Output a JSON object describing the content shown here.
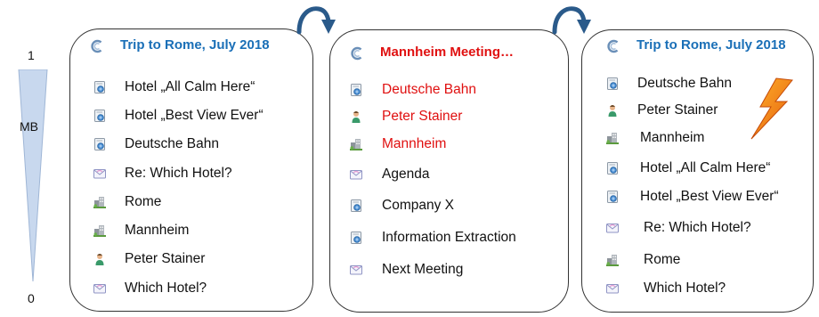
{
  "scale": {
    "top": "1",
    "label": "MB",
    "bottom": "0"
  },
  "colors": {
    "blue_title": "#1a6fb7",
    "red_title": "#e01010",
    "highlight": "#e01010",
    "arrow": "#2a5a8a",
    "wedge": "#c8d8ee"
  },
  "panels": [
    {
      "title": "Trip to Rome, July 2018",
      "title_color": "#1a6fb7",
      "items": [
        {
          "icon": "document-icon",
          "label": "Hotel „All Calm Here“",
          "highlight": false
        },
        {
          "icon": "document-icon",
          "label": "Hotel „Best View Ever“",
          "highlight": false
        },
        {
          "icon": "document-icon",
          "label": "Deutsche Bahn",
          "highlight": false
        },
        {
          "icon": "envelope-icon",
          "label": "Re: Which Hotel?",
          "highlight": false
        },
        {
          "icon": "building-icon",
          "label": "Rome",
          "highlight": false
        },
        {
          "icon": "building-icon",
          "label": "Mannheim",
          "highlight": false
        },
        {
          "icon": "person-icon",
          "label": "Peter Stainer",
          "highlight": false
        },
        {
          "icon": "envelope-icon",
          "label": "Which Hotel?",
          "highlight": false
        }
      ]
    },
    {
      "title": "Mannheim Meeting…",
      "title_color": "#e01010",
      "items": [
        {
          "icon": "document-icon",
          "label": "Deutsche Bahn",
          "highlight": true
        },
        {
          "icon": "person-icon",
          "label": "Peter Stainer",
          "highlight": true
        },
        {
          "icon": "building-icon",
          "label": "Mannheim",
          "highlight": true
        },
        {
          "icon": "envelope-icon",
          "label": "Agenda",
          "highlight": false
        },
        {
          "icon": "document-icon",
          "label": "Company X",
          "highlight": false
        },
        {
          "icon": "document-icon",
          "label": "Information Extraction",
          "highlight": false
        },
        {
          "icon": "envelope-icon",
          "label": "Next Meeting",
          "highlight": false
        }
      ]
    },
    {
      "title": "Trip to Rome, July 2018",
      "title_color": "#1a6fb7",
      "items": [
        {
          "icon": "document-icon",
          "label": "Deutsche Bahn",
          "highlight": false
        },
        {
          "icon": "person-icon",
          "label": "Peter Stainer",
          "highlight": false
        },
        {
          "icon": "building-icon",
          "label": "Mannheim",
          "highlight": false
        },
        {
          "icon": "document-icon",
          "label": "Hotel „All Calm Here“",
          "highlight": false
        },
        {
          "icon": "document-icon",
          "label": "Hotel „Best View Ever“",
          "highlight": false
        },
        {
          "icon": "envelope-icon",
          "label": "Re: Which Hotel?",
          "highlight": false
        },
        {
          "icon": "building-icon",
          "label": "Rome",
          "highlight": false
        },
        {
          "icon": "envelope-icon",
          "label": "Which Hotel?",
          "highlight": false
        }
      ]
    }
  ]
}
